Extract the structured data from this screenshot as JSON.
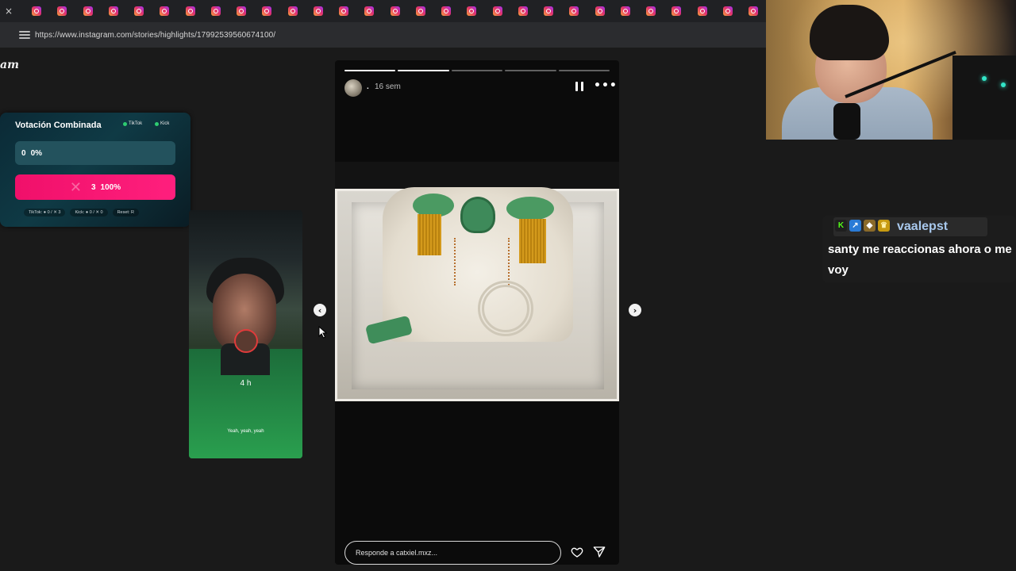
{
  "browser": {
    "tab_close": "×",
    "tab_count": 29,
    "url": "https://www.instagram.com/stories/highlights/17992539560674100/"
  },
  "instagram": {
    "logo_partial": "am"
  },
  "vote_widget": {
    "title": "Votación Combinada",
    "platforms": [
      "TikTok",
      "Kick"
    ],
    "option1": {
      "count": "0",
      "percent": "0%"
    },
    "option2": {
      "count": "3",
      "percent": "100%"
    },
    "stats": {
      "tiktok": "TikTok: ● 0 / ✕ 3",
      "kick": "Kick: ● 0 / ✕ 0",
      "reset": "Reset: R"
    },
    "colors": {
      "option1": "#23525d",
      "option2": "#f0106a"
    }
  },
  "preview_story": {
    "time": "4 h",
    "caption": "Yeah, yeah, yeah"
  },
  "story": {
    "username": ".",
    "time": "16 sem",
    "progress_segments": 5,
    "progress_current": 2,
    "reply_placeholder": "Responde a catxiel.mxz...",
    "prev_arrow": "‹",
    "next_arrow": "›"
  },
  "chat": {
    "username": "vaalepst",
    "badges": [
      "K",
      "↗",
      "◆",
      "♛"
    ],
    "message": "santy me reaccionas ahora o me voy",
    "accent": "#a8c8ec"
  }
}
